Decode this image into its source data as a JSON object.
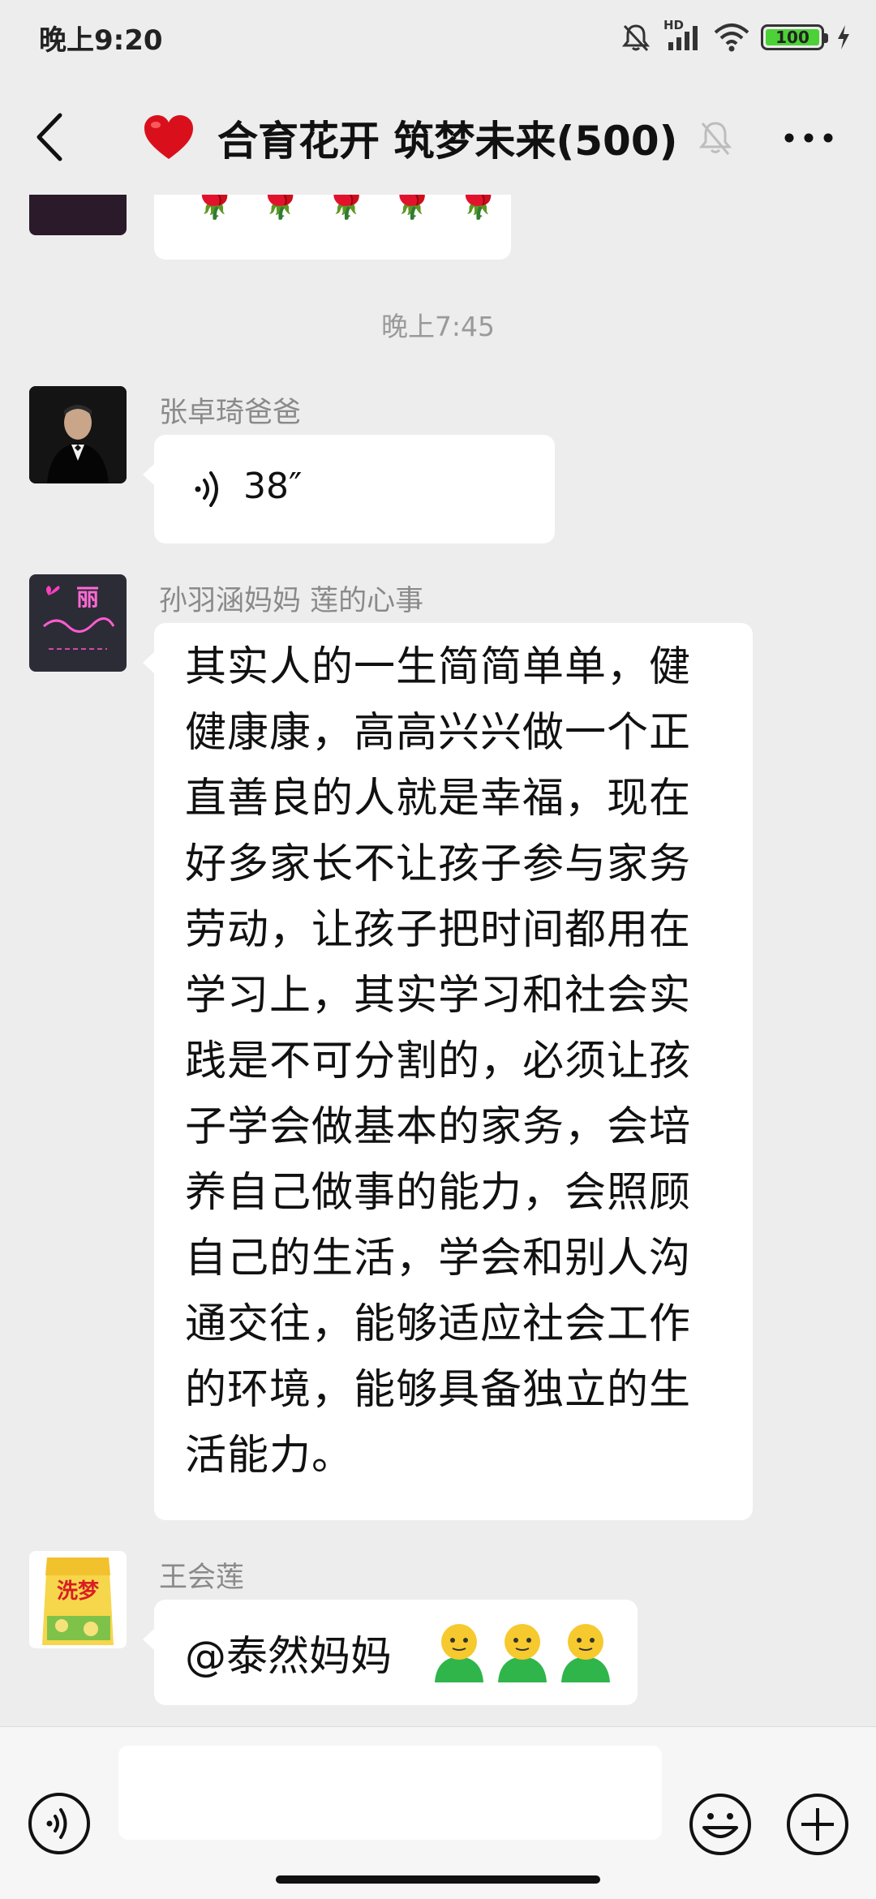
{
  "status_bar": {
    "time": "晚上9:20",
    "network_label": "HD",
    "battery_text": "100",
    "battery_level": 1.0,
    "icons": [
      "mute-icon",
      "signal-icon",
      "wifi-icon",
      "battery-icon",
      "charging-icon"
    ]
  },
  "nav": {
    "title": "合育花开 筑梦未来(500)",
    "icons": [
      "back-icon",
      "heart-icon",
      "bell-muted-icon",
      "more-icon"
    ]
  },
  "chat": {
    "top_emoji": "🌹 🌹 🌹 🌹 🌹",
    "timestamp": "晚上7:45",
    "messages": [
      {
        "sender": "张卓琦爸爸",
        "type": "voice",
        "duration": "38″",
        "avatar": "man-in-suit-avatar"
      },
      {
        "sender": "孙羽涵妈妈  莲的心事",
        "type": "text",
        "avatar": "neon-sign-avatar",
        "lines": [
          "其实人的一生简简单单，健",
          "健康康，高高兴兴做一个正",
          "直善良的人就是幸福，现在",
          "好多家长不让孩子参与家务",
          "劳动，让孩子把时间都用在",
          "学习上，其实学习和社会实",
          "践是不可分割的，必须让孩",
          "子学会做基本的家务，会培",
          "养自己做事的能力，会照顾",
          "自己的生活，学会和别人沟",
          "通交往，能够适应社会工作",
          "的环境，能够具备独立的生",
          "活能力。"
        ]
      },
      {
        "sender": "王会莲",
        "type": "text",
        "avatar": "rice-bag-avatar",
        "mention": "@泰然妈妈",
        "avatar_text": "洗梦"
      }
    ]
  },
  "input_bar": {
    "value": "",
    "icons": [
      "voice-input-icon",
      "emoji-icon",
      "plus-icon"
    ]
  }
}
